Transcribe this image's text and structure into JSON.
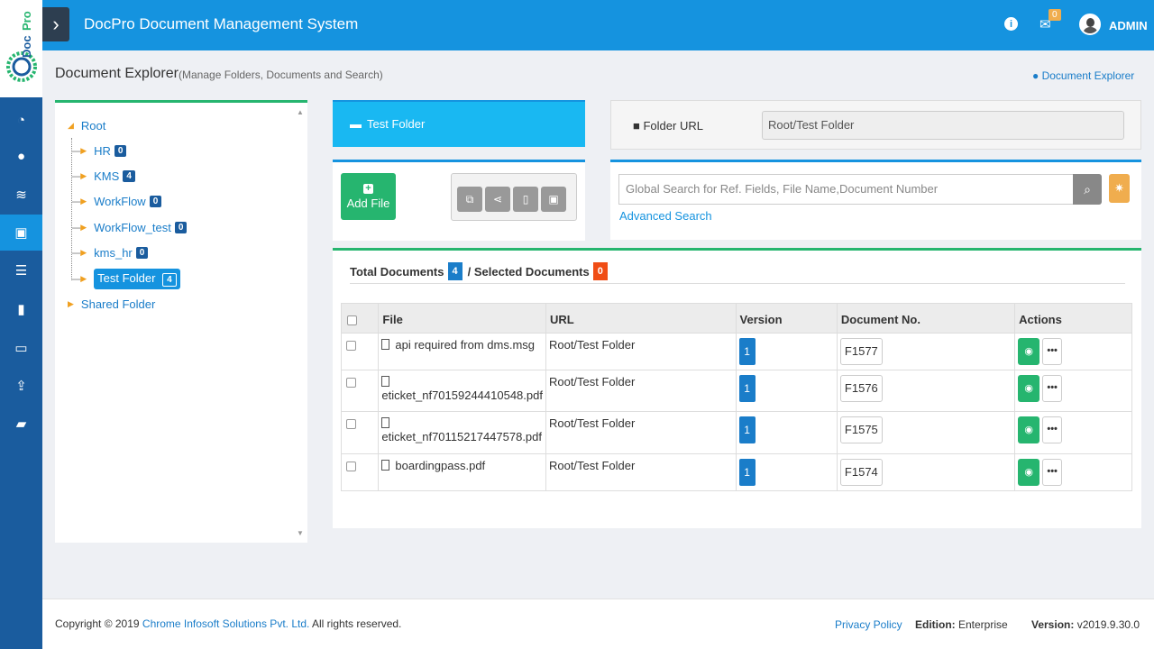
{
  "topbar": {
    "app_title": "DocPro Document Management System",
    "notif_count": "0",
    "user": "ADMIN"
  },
  "logo": {
    "text": "DocPro"
  },
  "header": {
    "title": "Document Explorer",
    "subtitle": "(Manage Folders, Documents and Search)",
    "crumb": "Document Explorer"
  },
  "sidebar": {
    "items": [
      "dashboard-icon",
      "user-icon",
      "database-icon",
      "briefcase-icon",
      "list-icon",
      "bookmark-icon",
      "folder-icon",
      "upload-icon",
      "book-icon"
    ],
    "active_index": 3
  },
  "tree": {
    "root": "Root",
    "children": [
      {
        "label": "HR",
        "count": "0"
      },
      {
        "label": "KMS",
        "count": "4"
      },
      {
        "label": "WorkFlow",
        "count": "0"
      },
      {
        "label": "WorkFlow_test",
        "count": "0"
      },
      {
        "label": "kms_hr",
        "count": "0"
      },
      {
        "label": "Test Folder",
        "count": "4",
        "selected": true
      }
    ],
    "shared": "Shared Folder"
  },
  "folder": {
    "name": "Test Folder",
    "url_label": "Folder URL",
    "url_value": "Root/Test Folder"
  },
  "toolbar": {
    "add_file": "Add File"
  },
  "search": {
    "placeholder": "Global Search for Ref. Fields, File Name,Document Number",
    "advanced": "Advanced Search"
  },
  "documents": {
    "total_label": "Total Documents",
    "total_count": "4",
    "selected_label": "/ Selected Documents",
    "selected_count": "0",
    "columns": [
      "File",
      "URL",
      "Version",
      "Document No.",
      "Actions"
    ],
    "rows": [
      {
        "file": "api required from dms.msg",
        "url": "Root/Test Folder",
        "version": "1",
        "doc_no": "F1577"
      },
      {
        "file": "eticket_nf70159244410548.pdf",
        "url": "Root/Test Folder",
        "version": "1",
        "doc_no": "F1576"
      },
      {
        "file": "eticket_nf70115217447578.pdf",
        "url": "Root/Test Folder",
        "version": "1",
        "doc_no": "F1575"
      },
      {
        "file": "boardingpass.pdf",
        "url": "Root/Test Folder",
        "version": "1",
        "doc_no": "F1574"
      }
    ]
  },
  "footer": {
    "copyright_prefix": "Copyright © 2019",
    "company": "Chrome Infosoft Solutions Pvt. Ltd.",
    "rights": "All rights reserved.",
    "privacy": "Privacy Policy",
    "edition_label": "Edition:",
    "edition_value": "Enterprise",
    "version_label": "Version:",
    "version_value": "v2019.9.30.0"
  },
  "colors": {
    "topbar": "#1593df",
    "sidebar": "#1a5c9e",
    "success": "#26b56f",
    "warning": "#f0ad4e",
    "danger": "#f04d15"
  }
}
